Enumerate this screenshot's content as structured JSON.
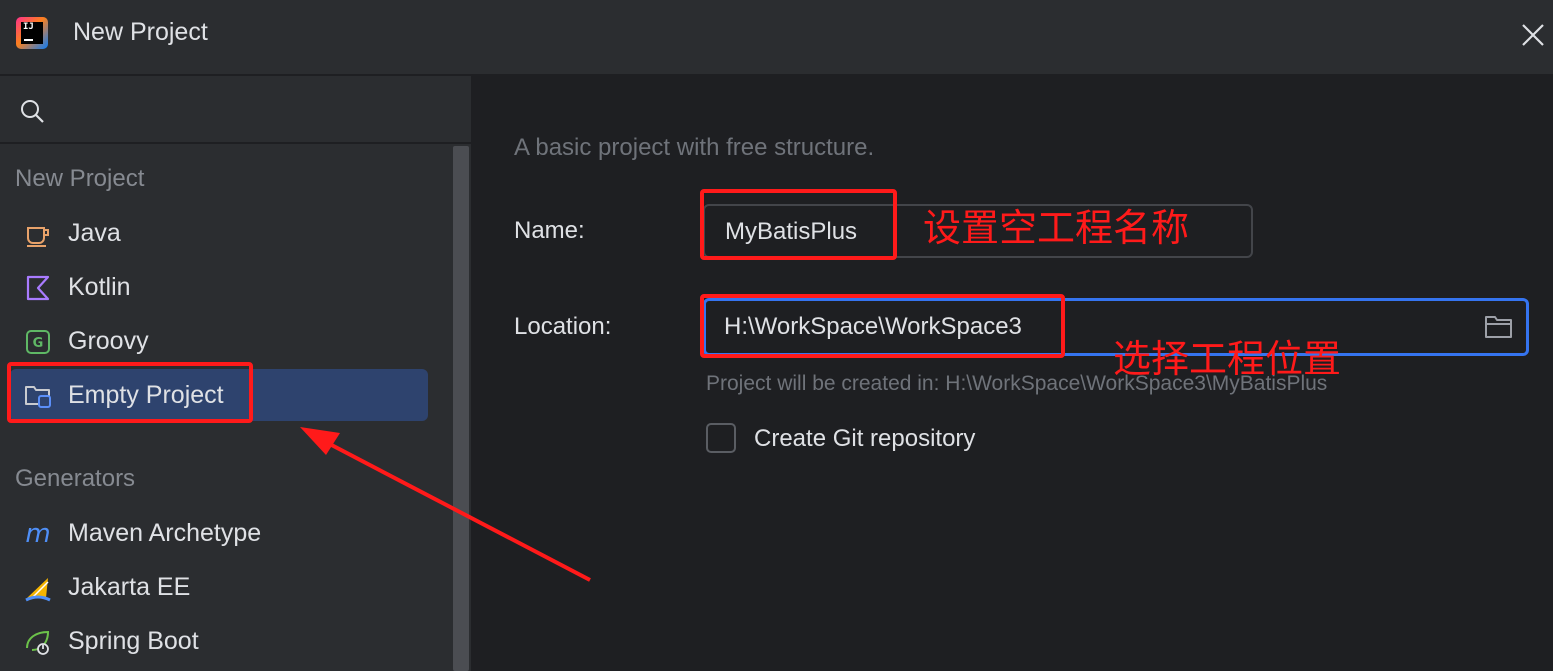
{
  "window": {
    "title": "New Project"
  },
  "sidebar": {
    "search_label": "search",
    "section_new_project": "New Project",
    "items": [
      {
        "label": "Java",
        "icon": "java-icon"
      },
      {
        "label": "Kotlin",
        "icon": "kotlin-icon"
      },
      {
        "label": "Groovy",
        "icon": "groovy-icon"
      },
      {
        "label": "Empty Project",
        "icon": "empty-project-icon",
        "selected": true
      }
    ],
    "section_generators": "Generators",
    "generators": [
      {
        "label": "Maven Archetype",
        "icon": "maven-icon"
      },
      {
        "label": "Jakarta EE",
        "icon": "jakarta-icon"
      },
      {
        "label": "Spring Boot",
        "icon": "spring-boot-icon"
      }
    ]
  },
  "main": {
    "description": "A basic project with free structure.",
    "name_label": "Name:",
    "name_value": "MyBatisPlus",
    "location_label": "Location:",
    "location_value": "H:\\WorkSpace\\WorkSpace3",
    "hint": "Project will be created in: H:\\WorkSpace\\WorkSpace3\\MyBatisPlus",
    "git_label": "Create Git repository",
    "git_checked": false
  },
  "annotations": {
    "name_note": "设置空工程名称",
    "location_note": "选择工程位置",
    "color": "#ff1a1a"
  },
  "colors": {
    "accent": "#3574f0",
    "selection": "#2e436e",
    "annotation": "#ff1a1a"
  }
}
